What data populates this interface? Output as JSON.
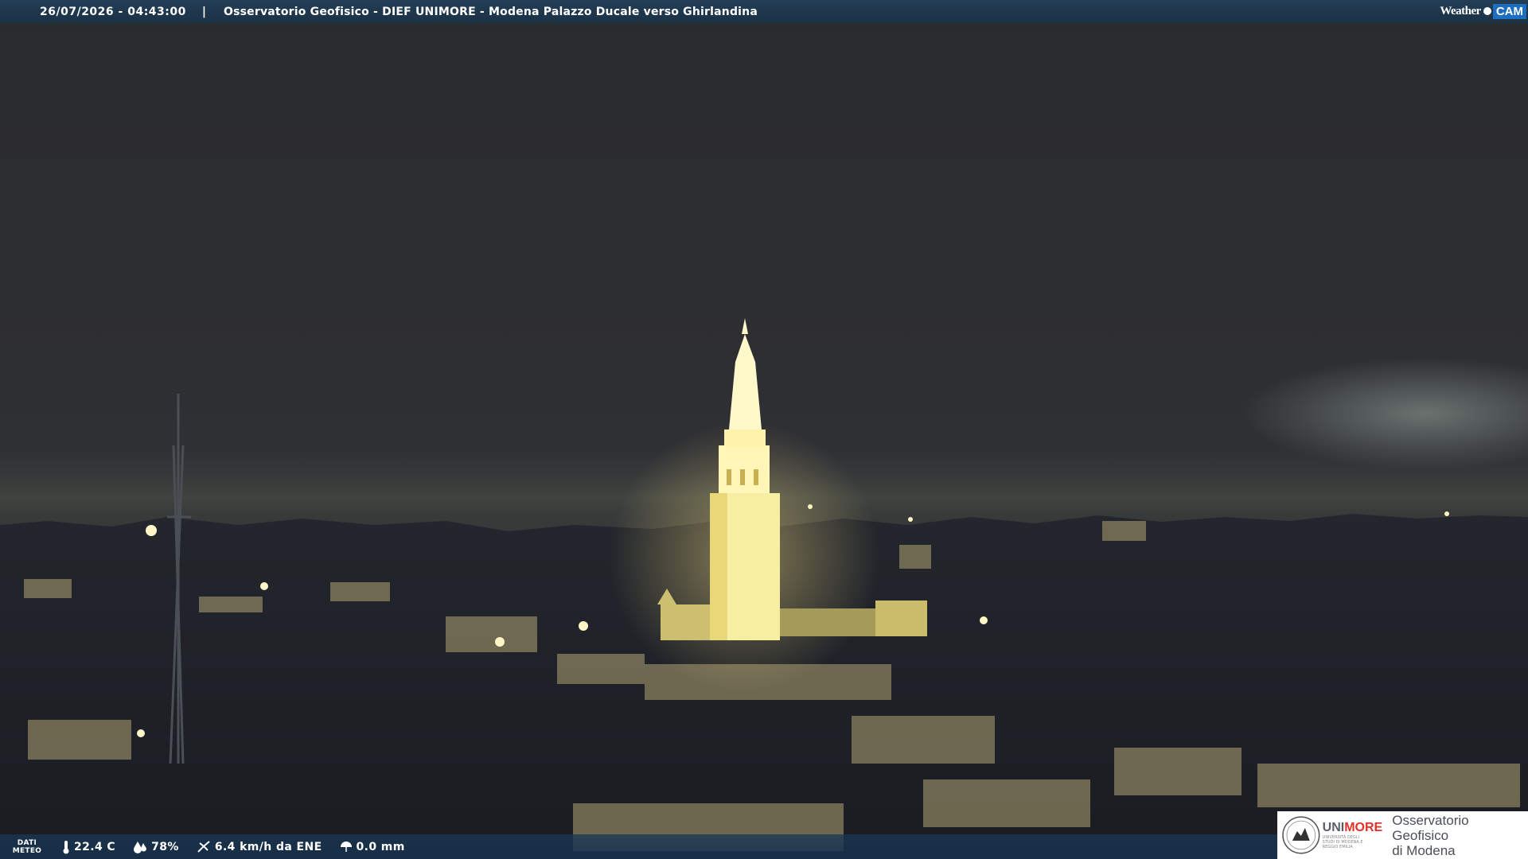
{
  "header": {
    "timestamp": "26/07/2026 - 04:43:00",
    "separator": "|",
    "title": "Osservatorio Geofisico - DIEF UNIMORE - Modena Palazzo Ducale verso Ghirlandina"
  },
  "brand_logo": {
    "weather_text": "Weather",
    "cam_text": "CAM",
    "icon": "weathercam-globe-icon",
    "cam_color": "#1d6ec0"
  },
  "meteo": {
    "label_line1": "DATI",
    "label_line2": "METEO",
    "temperature": "22.4 C",
    "humidity": "78%",
    "wind": "6.4 km/h da ENE",
    "rain": "0.0 mm",
    "icons": [
      "thermometer-icon",
      "humidity-drop-icon",
      "wind-icon",
      "rain-umbrella-icon"
    ]
  },
  "institution": {
    "name_part1": "UNI",
    "name_part2": "MORE",
    "subtitle": "UNIVERSITÀ DEGLI STUDI DI MODENA E REGGIO EMILIA",
    "observatory_line1": "Osservatorio Geofisico",
    "observatory_line2": "di Modena",
    "accent_color": "#e2322a"
  }
}
